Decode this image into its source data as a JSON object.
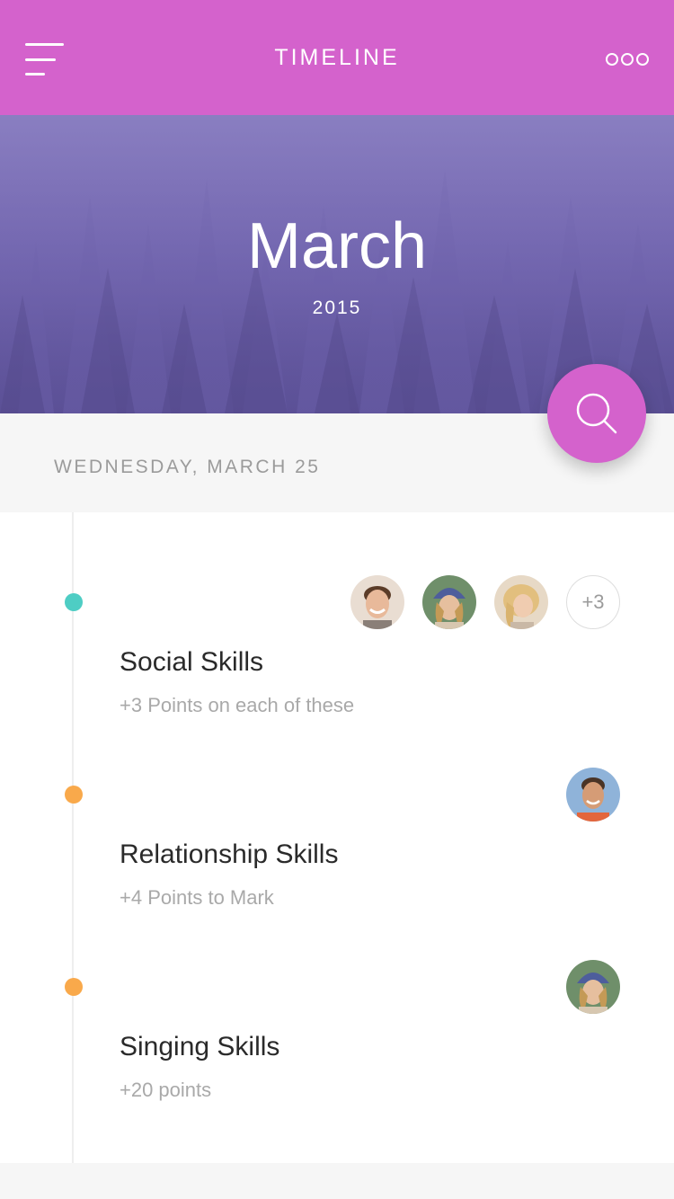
{
  "header": {
    "title": "TIMELINE",
    "menu_icon": "hamburger-menu-icon",
    "more_icon": "more-dots-icon",
    "color": "#d462cc"
  },
  "hero": {
    "month": "March",
    "year": "2015"
  },
  "date_bar": {
    "date": "WEDNESDAY, MARCH 25"
  },
  "fab": {
    "icon": "search-icon",
    "color": "#d462cc"
  },
  "timeline": {
    "entries": [
      {
        "title": "Social Skills",
        "subtitle": "+3 Points on each of these",
        "dot_color": "#4ecdc4",
        "avatars": [
          "avatar-man-smiling",
          "avatar-woman-beanie",
          "avatar-woman-blonde"
        ],
        "more_count": "+3"
      },
      {
        "title": "Relationship Skills",
        "subtitle": "+4 Points to Mark",
        "dot_color": "#f9a94b",
        "avatars": [
          "avatar-man-outdoor"
        ]
      },
      {
        "title": "Singing Skills",
        "subtitle": "+20 points",
        "dot_color": "#f9a94b",
        "avatars": [
          "avatar-woman-beanie"
        ]
      }
    ]
  }
}
